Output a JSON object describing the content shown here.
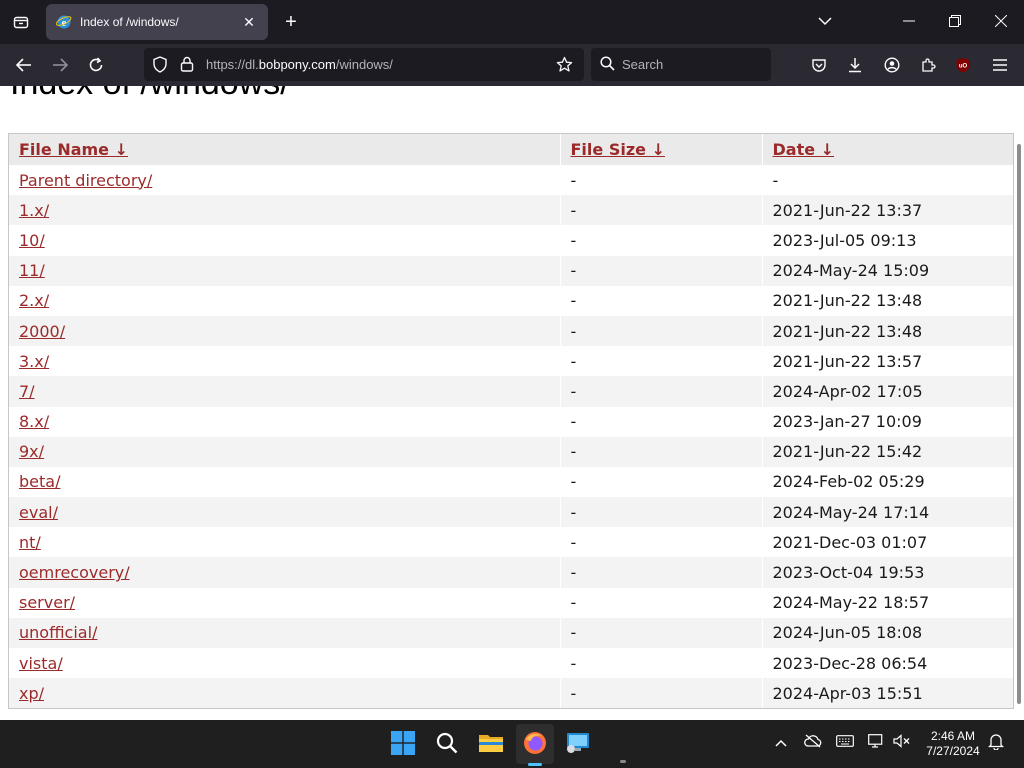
{
  "browser": {
    "tab": {
      "title": "Index of /windows/"
    },
    "url": {
      "prefix": "https://dl.",
      "host": "bobpony.com",
      "path": "/windows/"
    },
    "search_placeholder": "Search"
  },
  "page": {
    "title": "Index of /windows/",
    "columns": {
      "name": "File Name ↓",
      "size": "File Size ↓",
      "date": "Date ↓"
    },
    "rows": [
      {
        "name": "Parent directory/",
        "size": "-",
        "date": "-"
      },
      {
        "name": "1.x/",
        "size": "-",
        "date": "2021-Jun-22 13:37"
      },
      {
        "name": "10/",
        "size": "-",
        "date": "2023-Jul-05 09:13"
      },
      {
        "name": "11/",
        "size": "-",
        "date": "2024-May-24 15:09"
      },
      {
        "name": "2.x/",
        "size": "-",
        "date": "2021-Jun-22 13:48"
      },
      {
        "name": "2000/",
        "size": "-",
        "date": "2021-Jun-22 13:48"
      },
      {
        "name": "3.x/",
        "size": "-",
        "date": "2021-Jun-22 13:57"
      },
      {
        "name": "7/",
        "size": "-",
        "date": "2024-Apr-02 17:05"
      },
      {
        "name": "8.x/",
        "size": "-",
        "date": "2023-Jan-27 10:09"
      },
      {
        "name": "9x/",
        "size": "-",
        "date": "2021-Jun-22 15:42"
      },
      {
        "name": "beta/",
        "size": "-",
        "date": "2024-Feb-02 05:29"
      },
      {
        "name": "eval/",
        "size": "-",
        "date": "2024-May-24 17:14"
      },
      {
        "name": "nt/",
        "size": "-",
        "date": "2021-Dec-03 01:07"
      },
      {
        "name": "oemrecovery/",
        "size": "-",
        "date": "2023-Oct-04 19:53"
      },
      {
        "name": "server/",
        "size": "-",
        "date": "2024-May-22 18:57"
      },
      {
        "name": "unofficial/",
        "size": "-",
        "date": "2024-Jun-05 18:08"
      },
      {
        "name": "vista/",
        "size": "-",
        "date": "2023-Dec-28 06:54"
      },
      {
        "name": "xp/",
        "size": "-",
        "date": "2024-Apr-03 15:51"
      }
    ]
  },
  "taskbar": {
    "time": "2:46 AM",
    "date": "7/27/2024"
  },
  "colors": {
    "link": "#9b2b2b",
    "chrome_dark": "#1c1b22",
    "toolbar": "#2b2a33",
    "taskbar": "#1f1f1f"
  }
}
